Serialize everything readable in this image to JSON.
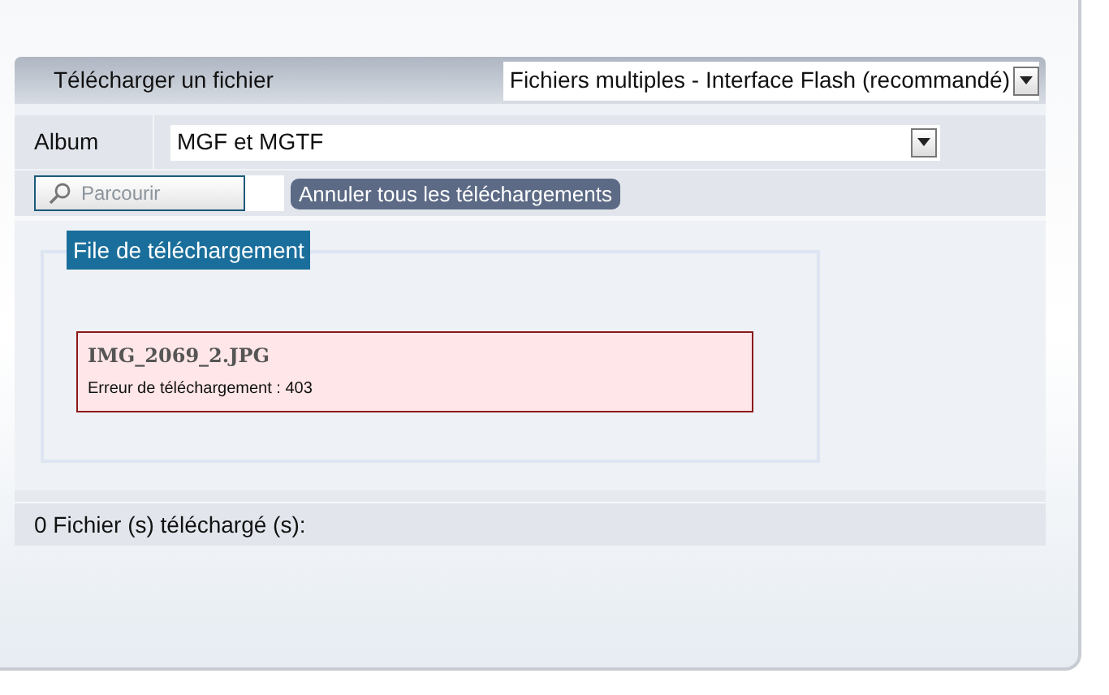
{
  "header": {
    "title": "Télécharger un fichier",
    "mode_select": "Fichiers multiples - Interface Flash (recommandé)"
  },
  "album": {
    "label": "Album",
    "value": "MGF et MGTF"
  },
  "browse_button": {
    "label": "Parcourir",
    "disabled": true
  },
  "cancel_all_button": "Annuler tous les téléchargements",
  "queue": {
    "title": "File de téléchargement",
    "items": [
      {
        "filename": "IMG_2069_2.JPG",
        "message": "Erreur de téléchargement : 403",
        "kind": "error"
      }
    ]
  },
  "footer": "0 Fichier (s) téléchargé (s):"
}
